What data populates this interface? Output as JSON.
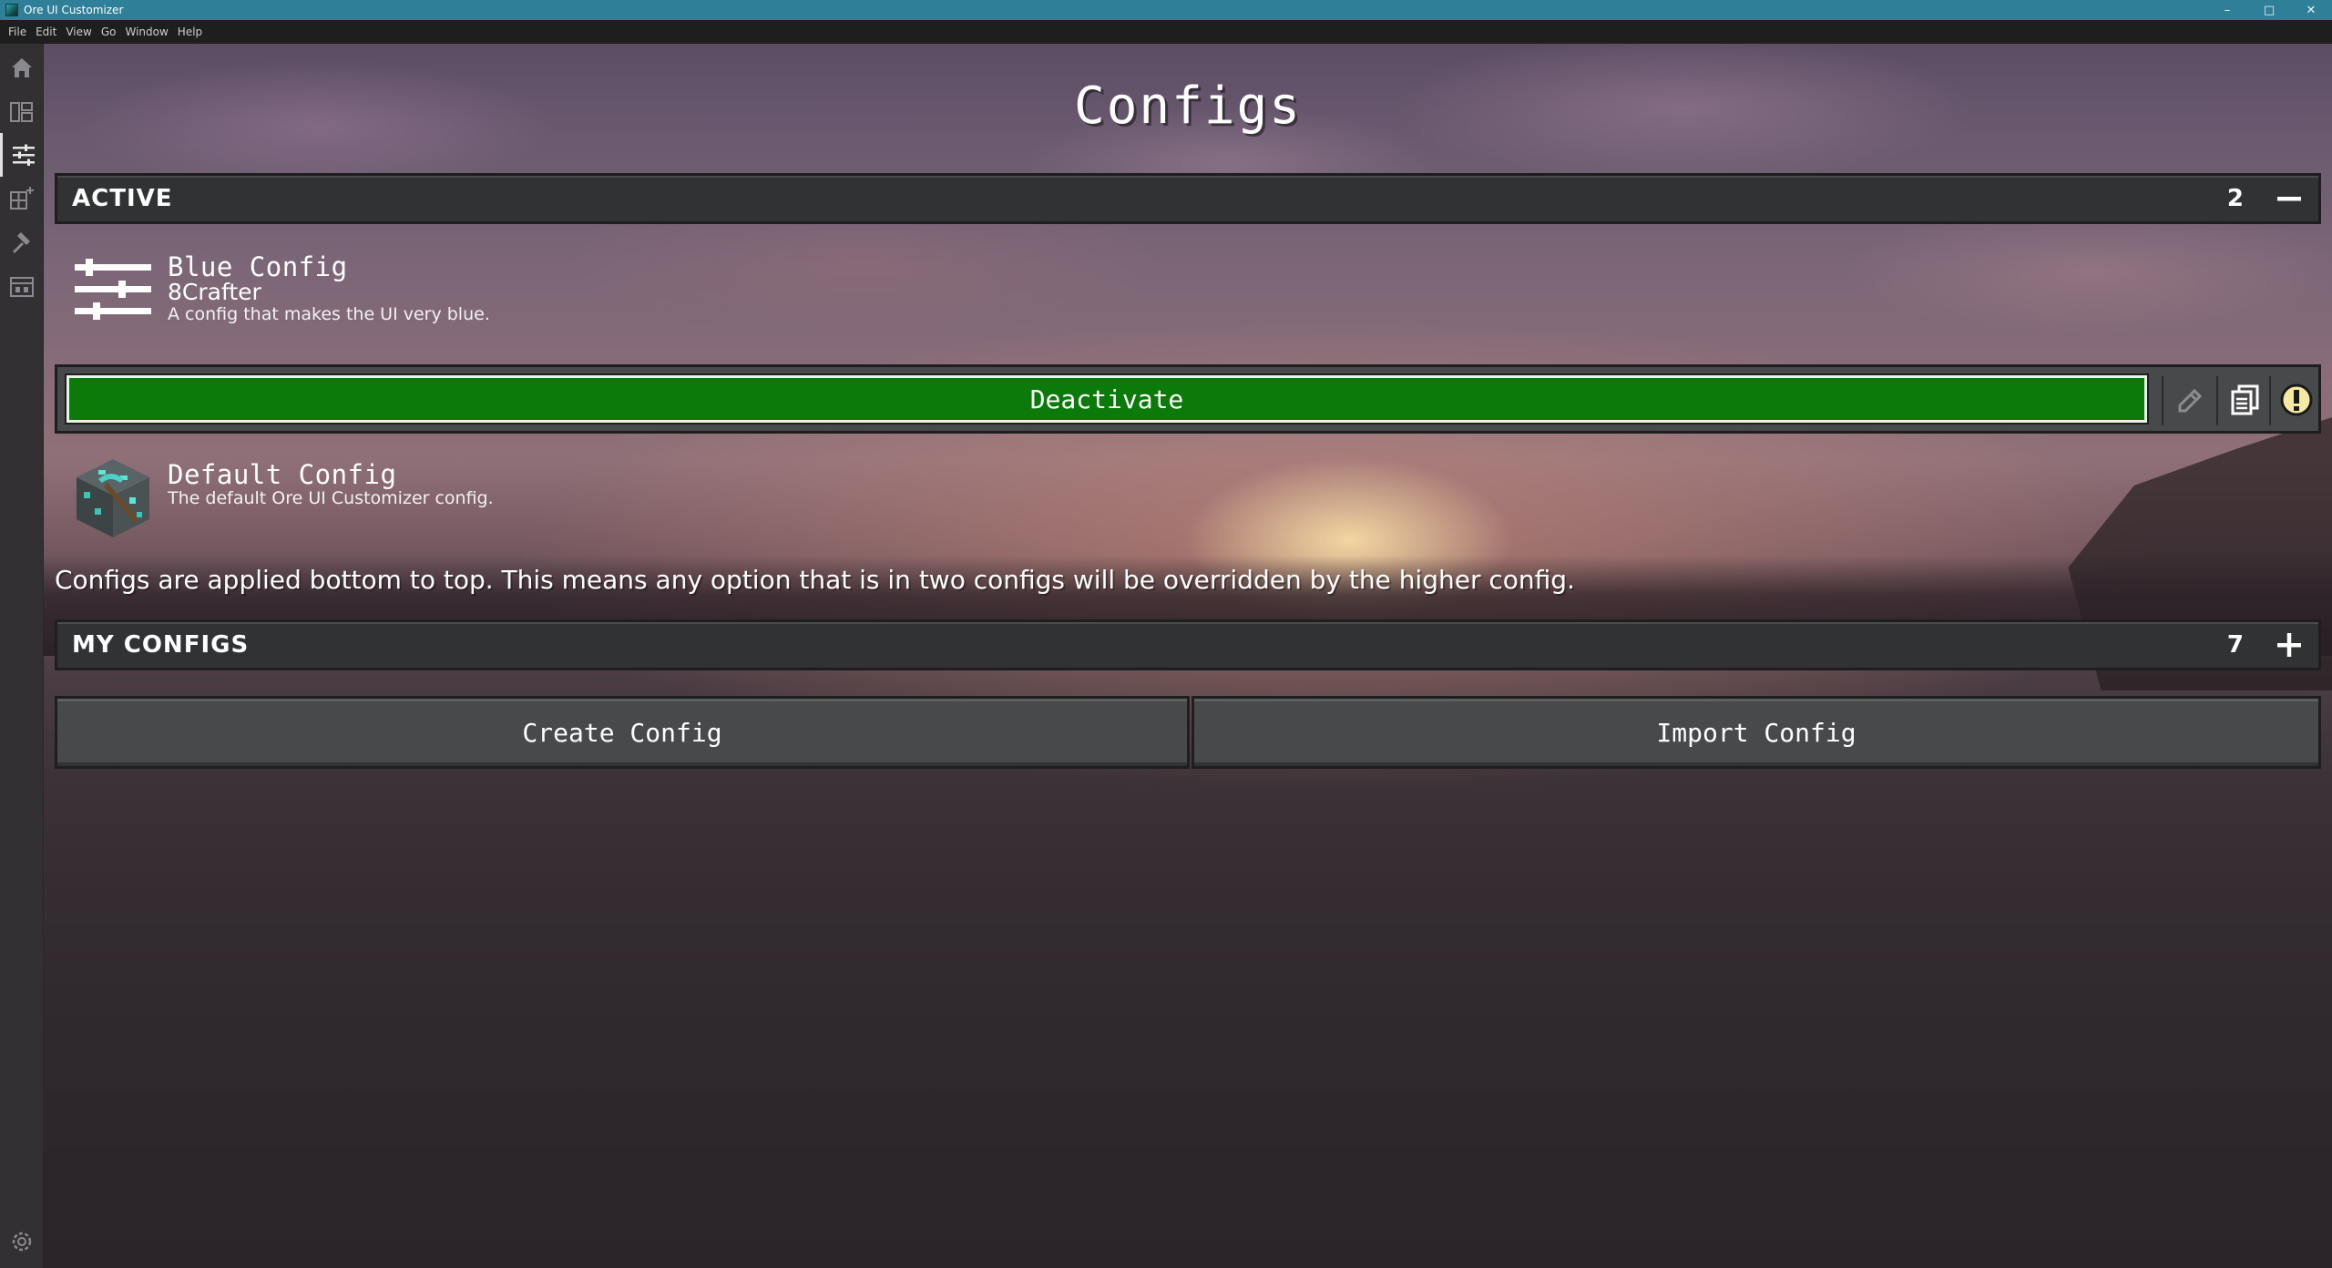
{
  "window": {
    "title": "Ore UI Customizer",
    "controls": {
      "minimize": "–",
      "maximize": "□",
      "close": "✕"
    }
  },
  "menubar": {
    "items": [
      "File",
      "Edit",
      "View",
      "Go",
      "Window",
      "Help"
    ]
  },
  "sidebar": {
    "items": [
      {
        "name": "home",
        "icon": "home-icon"
      },
      {
        "name": "layout",
        "icon": "layout-icon"
      },
      {
        "name": "configs",
        "icon": "sliders-icon",
        "active": true
      },
      {
        "name": "add-plugin",
        "icon": "plugin-add-icon"
      },
      {
        "name": "tools",
        "icon": "hammer-icon"
      },
      {
        "name": "store",
        "icon": "store-icon"
      }
    ],
    "settings_icon": "gear-icon"
  },
  "page": {
    "title": "Configs"
  },
  "active_section": {
    "title": "ACTIVE",
    "count": "2",
    "toggle_icon": "minus-icon",
    "configs": [
      {
        "name": "Blue Config",
        "author": "8Crafter",
        "description": "A config that makes the UI very blue.",
        "icon": "sliders-icon"
      },
      {
        "name": "Default Config",
        "description": "The default Ore UI Customizer config.",
        "icon": "diamond-ore-pickaxe-icon"
      }
    ],
    "actions": {
      "deactivate_label": "Deactivate",
      "deactivate_color": "#0b7a0b",
      "edit_icon": "pencil-icon",
      "copy_icon": "copy-icon",
      "info_icon": "info-icon"
    }
  },
  "info_text": "Configs are applied bottom to top. This means any option that is in two configs will be overridden by the higher config.",
  "my_configs_section": {
    "title": "MY CONFIGS",
    "count": "7",
    "toggle_icon": "plus-icon"
  },
  "buttons": {
    "create_label": "Create Config",
    "import_label": "Import Config"
  }
}
